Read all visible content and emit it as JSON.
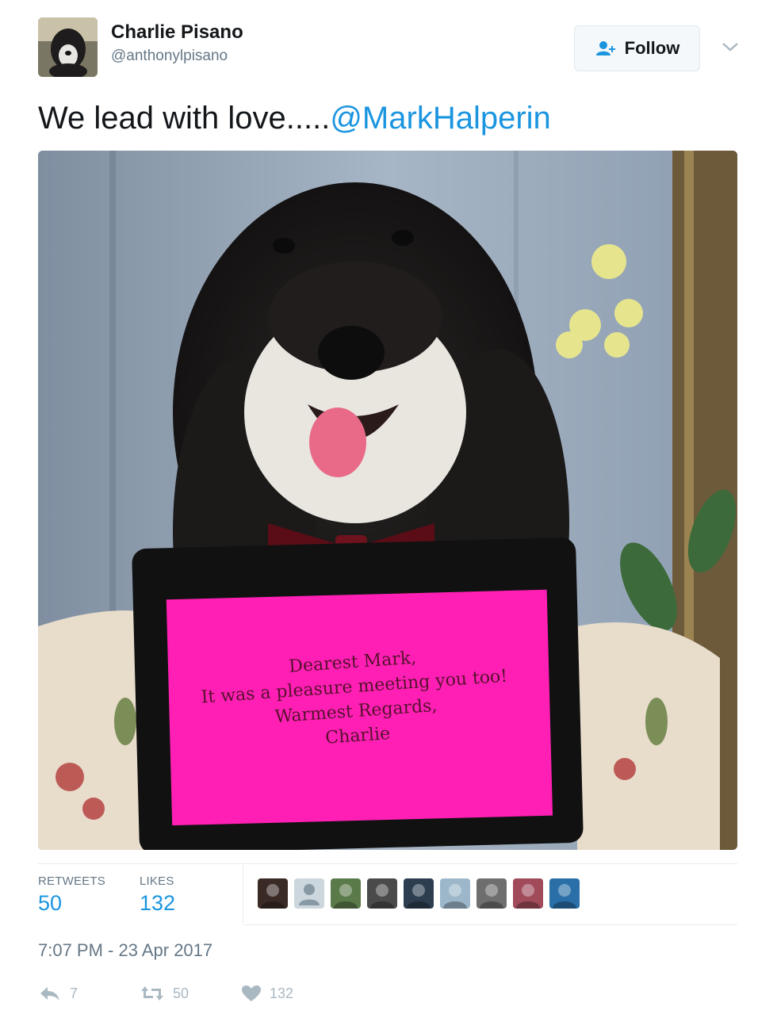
{
  "user": {
    "display_name": "Charlie Pisano",
    "handle": "@anthonylpisano"
  },
  "follow_button": {
    "label": "Follow"
  },
  "tweet": {
    "text": "We lead with love.....",
    "mention": "@MarkHalperin"
  },
  "photo": {
    "tablet_text": [
      "Dearest Mark,",
      "It was a pleasure meeting you too!",
      "Warmest Regards,",
      "Charlie"
    ]
  },
  "stats": {
    "retweets_label": "RETWEETS",
    "retweets_value": "50",
    "likes_label": "LIKES",
    "likes_value": "132"
  },
  "likers": [
    {
      "name": "liker-avatar-1",
      "color": "#3a2a26"
    },
    {
      "name": "liker-avatar-2",
      "color": "#ccd6dd"
    },
    {
      "name": "liker-avatar-3",
      "color": "#5b7a4a"
    },
    {
      "name": "liker-avatar-4",
      "color": "#4a4a4a"
    },
    {
      "name": "liker-avatar-5",
      "color": "#2c3e50"
    },
    {
      "name": "liker-avatar-6",
      "color": "#9cb7c9"
    },
    {
      "name": "liker-avatar-7",
      "color": "#6e6e6e"
    },
    {
      "name": "liker-avatar-8",
      "color": "#a04a5a"
    },
    {
      "name": "liker-avatar-9",
      "color": "#2a6fa8"
    }
  ],
  "timestamp": "7:07 PM - 23 Apr 2017",
  "actions": {
    "reply_count": "7",
    "retweet_count": "50",
    "like_count": "132"
  },
  "colors": {
    "accent": "#1b95e0",
    "muted": "#657786",
    "icon_muted": "#aab8c2",
    "tablet_screen": "#ff1fb4"
  }
}
